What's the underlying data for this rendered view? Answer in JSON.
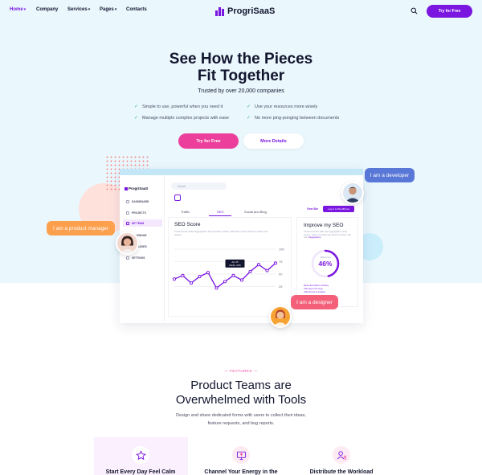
{
  "colors": {
    "brand": "#7a16e0",
    "cta": "#ec3f9b",
    "hero_bg": "#eaf7fd",
    "check": "#34b37a"
  },
  "nav": {
    "items": [
      {
        "label": "Home",
        "active": true,
        "has_menu": true
      },
      {
        "label": "Company",
        "active": false,
        "has_menu": false
      },
      {
        "label": "Services",
        "active": false,
        "has_menu": true
      },
      {
        "label": "Pages",
        "active": false,
        "has_menu": true
      },
      {
        "label": "Contacts",
        "active": false,
        "has_menu": false
      }
    ],
    "logo": "ProgriSaaS",
    "search_icon": "search-icon",
    "cta_label": "Try for Free"
  },
  "hero": {
    "title_line1": "See How the Pieces",
    "title_line2": "Fit Together",
    "subtitle": "Trusted by over 20,000 companies",
    "checks": [
      "Simple to use, powerful when you need it",
      "Use your resources more wisely",
      "Manage multiple complex projects with ease",
      "No more ping-ponging between documents"
    ],
    "primary_button": "Try for Free",
    "secondary_button": "More Details"
  },
  "mockup": {
    "logo": "ProgriSaaS",
    "search_placeholder": "Search",
    "sidebar": [
      "DASHBOARD",
      "PROJECTS",
      "MY TEAM",
      "CALENDAR",
      "MESSAGES",
      "SETTINGS"
    ],
    "sidebar_active": 2,
    "tabs": [
      "Traffic",
      "SEO",
      "Social and Blog"
    ],
    "active_tab": 1,
    "view_button": "View Site",
    "login_button": "Log in to WordPress",
    "seo_card": {
      "title": "SEO Score",
      "description": "Trusted score based aggregation and opposite position. Relevant metrics shown in charts and reports."
    },
    "chart_tooltip": {
      "date": "Apr 15",
      "value": "Clicks: 21%"
    },
    "improve_card": {
      "title": "Improve my SEO",
      "description": "Trusted metrics with spot aggregation using source, order of results and facets to inform this site.",
      "link": "Suggestions",
      "gauge_label": "Total score",
      "gauge_value": "46%",
      "gauge_fraction": 0.46,
      "list": [
        "Meta description missing",
        "Title tag is too long",
        "Add alt text to images"
      ]
    }
  },
  "chart_data": {
    "type": "line",
    "title": "",
    "xlabel": "",
    "ylabel": "",
    "x": [
      1,
      2,
      3,
      4,
      5,
      6,
      7,
      8,
      9,
      10,
      11,
      12,
      13
    ],
    "y": [
      40,
      47,
      32,
      45,
      53,
      22,
      35,
      47,
      38,
      55,
      69,
      57,
      72
    ],
    "y_ticks": [
      100,
      75,
      50,
      25
    ],
    "ylim": [
      0,
      100
    ],
    "grid": true,
    "series": [
      {
        "name": "",
        "color": "#7a16e0"
      }
    ]
  },
  "bubbles": {
    "developer": "I am a developer",
    "product_manager": "I am a product manager",
    "designer": "I am a designer"
  },
  "features": {
    "tag": "FEATURES",
    "title_line1": "Product Teams are",
    "title_line2": "Overwhelmed with Tools",
    "description_line1": "Design and share dedicated forms with users to collect their ideas,",
    "description_line2": "feature requests, and bug reports.",
    "cards": [
      {
        "icon": "star-icon",
        "title": "Start Every Day Feel Calm"
      },
      {
        "icon": "monitor-icon",
        "title": "Channel Your Energy in the"
      },
      {
        "icon": "user-list-icon",
        "title": "Distribute the Workload"
      }
    ]
  }
}
